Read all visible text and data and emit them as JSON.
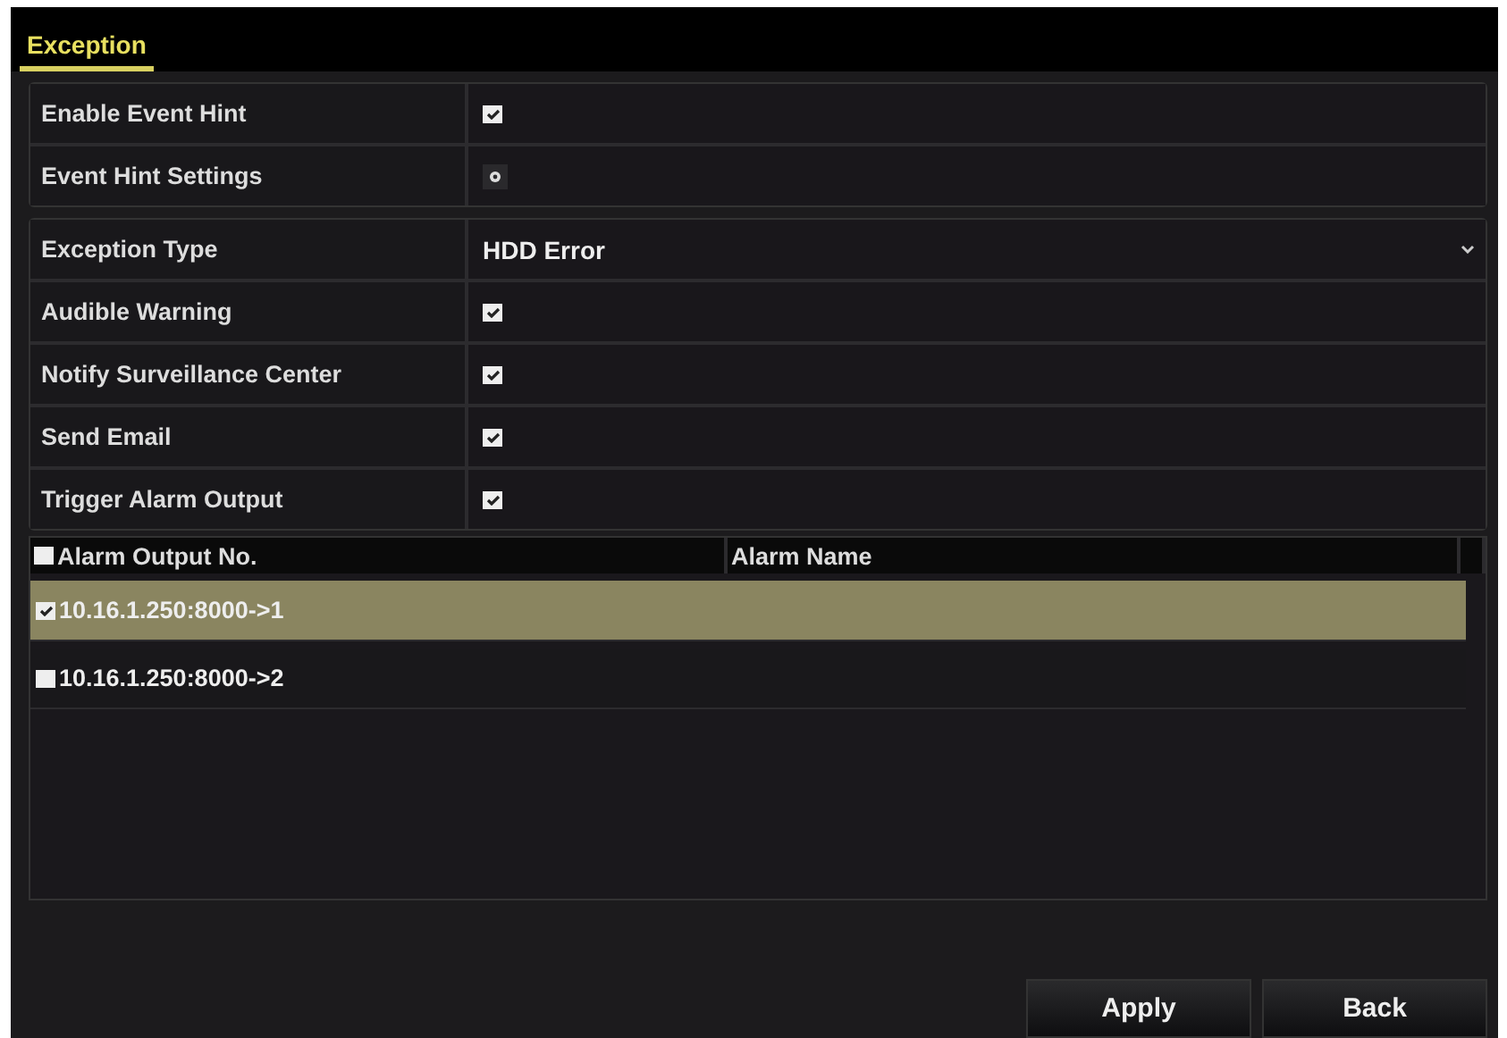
{
  "tabs": [
    {
      "label": "Exception",
      "selected": true
    }
  ],
  "groups": [
    {
      "rows": [
        {
          "label": "Enable Event Hint",
          "kind": "checkbox",
          "checked": true
        },
        {
          "label": "Event Hint Settings",
          "kind": "settings"
        }
      ]
    },
    {
      "rows": [
        {
          "label": "Exception Type",
          "kind": "dropdown",
          "value": "HDD Error"
        },
        {
          "label": "Audible Warning",
          "kind": "checkbox",
          "checked": true
        },
        {
          "label": "Notify Surveillance Center",
          "kind": "checkbox",
          "checked": true
        },
        {
          "label": "Send Email",
          "kind": "checkbox",
          "checked": true
        },
        {
          "label": "Trigger Alarm Output",
          "kind": "checkbox",
          "checked": true
        }
      ]
    }
  ],
  "table": {
    "select_all_checked": false,
    "columns": [
      "Alarm Output No.",
      "Alarm Name"
    ],
    "rows": [
      {
        "output": "10.16.1.250:8000->1",
        "checked": true,
        "selected": true
      },
      {
        "output": "10.16.1.250:8000->2",
        "checked": false,
        "selected": false
      }
    ]
  },
  "buttons": [
    "Apply",
    "Back"
  ]
}
